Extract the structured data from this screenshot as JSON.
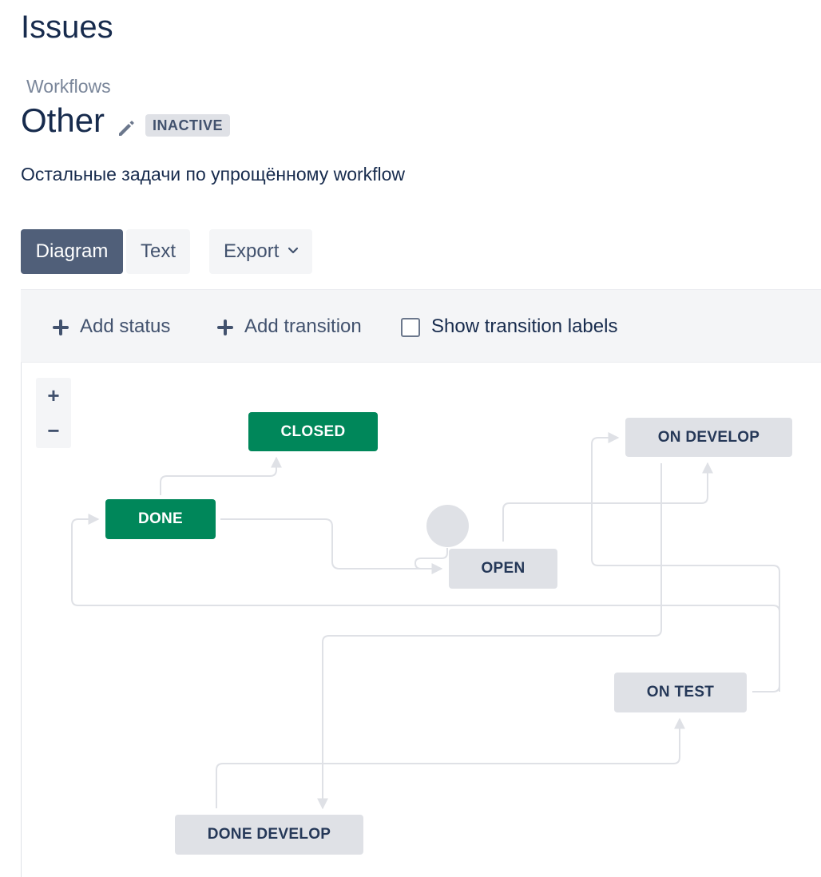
{
  "page": {
    "title": "Issues"
  },
  "breadcrumb": {
    "label": "Workflows"
  },
  "workflow": {
    "name": "Other",
    "status": "INACTIVE",
    "description": "Остальные задачи по упрощённому workflow"
  },
  "tabs": {
    "diagram": "Diagram",
    "text": "Text",
    "export": "Export"
  },
  "toolbar": {
    "add_status": "Add status",
    "add_transition": "Add transition",
    "show_labels": "Show transition labels",
    "show_labels_checked": false
  },
  "zoom": {
    "in": "+",
    "out": "−"
  },
  "statuses": {
    "closed": "CLOSED",
    "done": "DONE",
    "open": "OPEN",
    "on_develop": "ON DEVELOP",
    "on_test": "ON TEST",
    "done_develop": "DONE DEVELOP"
  },
  "colors": {
    "done_status": "#00875a",
    "todo_status": "#dfe1e6",
    "primary_tab": "#505f79"
  },
  "icons": {
    "edit": "pencil-icon",
    "export_caret": "chevron-down-icon",
    "add": "plus-icon"
  }
}
